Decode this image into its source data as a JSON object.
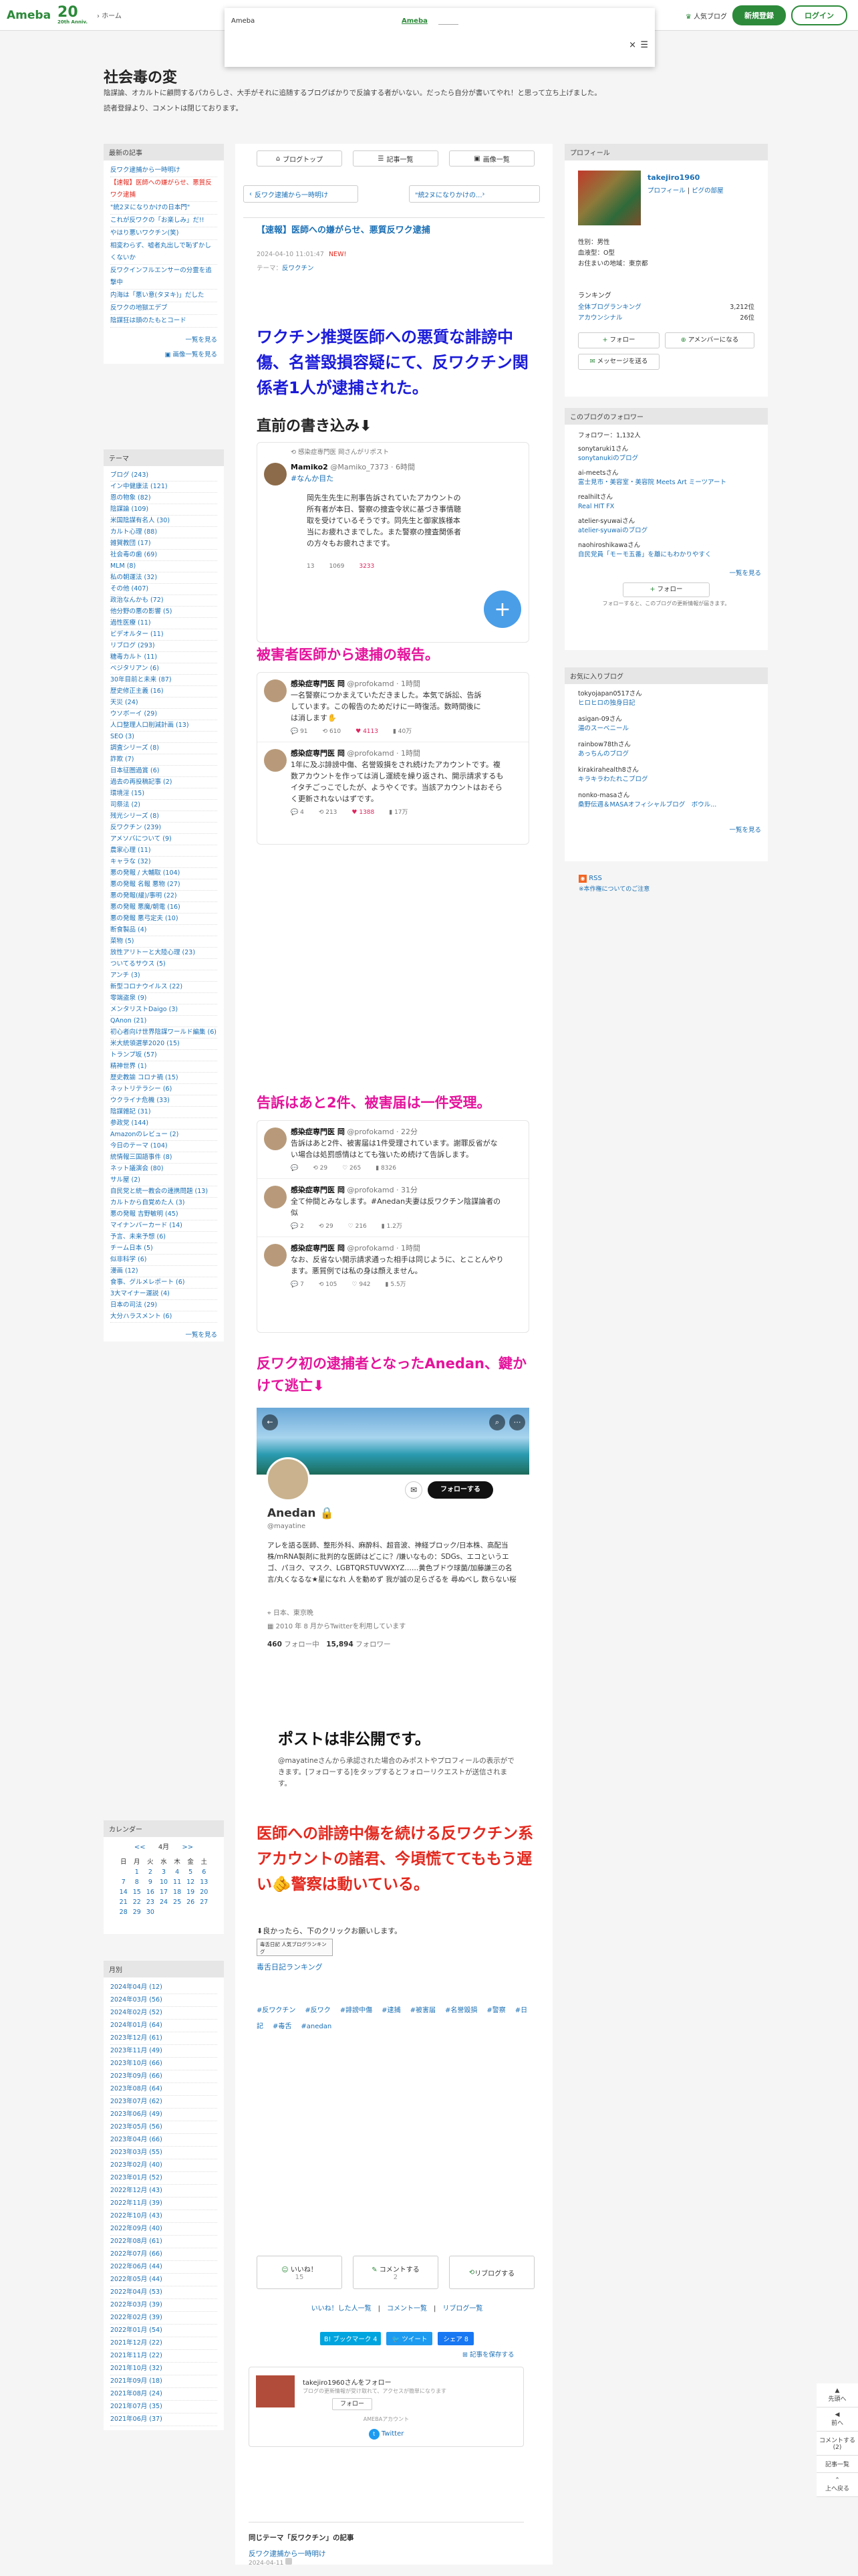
{
  "header": {
    "logo": "Ameba",
    "logo20": "20",
    "logo20_sub": "Ameba",
    "logo20_year": "20th Anniv.",
    "home": "ホーム",
    "popular": "人気ブログ",
    "signup": "新規登録",
    "login": "ログイン"
  },
  "popup": {
    "left": "Ameba",
    "mid": "Ameba",
    "close": "×"
  },
  "blog": {
    "title": "社会毒の変",
    "desc": "陰謀論、オカルトに顧問するパカらしさ、大手がそれに追随するブログばかりで反論する者がいない。だったら自分が書いてやれ！と思って立ち上げました。",
    "desc2": "読者登録より、コメントは閉じております。"
  },
  "left": {
    "recent_title": "最新の記事",
    "recent": [
      "反ワク逮捕から一時明け",
      "【速報】医師への嫌がらせ、悪質反ワク逮捕",
      "\"統2ヌになりかけの日本門\"",
      "これが反ワクの「お楽しみ」だ!!",
      "やはり悪いワクチン(笑)",
      "相変わらず、嘘者丸出しで恥ずかしくないか",
      "反ワクインフルエンサーの分霊を追撃中",
      "内海は「悪い意(タヌキ)」だした",
      "反ワクの地獄エデブ",
      "陰謀狂は頭のたもとコード"
    ],
    "recent_more": "一覧を見る",
    "recent_more2": "画像一覧を見る",
    "theme_title": "テーマ",
    "themes": [
      "ブログ (243)",
      "イン中健康法 (121)",
      "恩の物象 (82)",
      "陰謀論 (109)",
      "米国陰謀有名人 (30)",
      "カルト心理 (88)",
      "雑賀教団 (17)",
      "社会毒の歯 (69)",
      "MLM (8)",
      "私の朝運法 (32)",
      "その他 (407)",
      "政治なんかも (72)",
      "他分野の悪の影響 (5)",
      "過性医療 (11)",
      "ビデオルター (11)",
      "リブログ (293)",
      "糖毒カルト (11)",
      "ベジタリアン (6)",
      "30年目前と未来 (87)",
      "歴史修正主義 (16)",
      "天災 (24)",
      "ウソボーイ (29)",
      "人口整理人口削減計画 (13)",
      "SEO (3)",
      "調査シリーズ (8)",
      "詐欺 (7)",
      "日本征圏過賞 (6)",
      "過去の再投稿記事 (2)",
      "環境淫 (15)",
      "司祭法 (2)",
      "残光シリーズ (8)",
      "反ワクチン (239)",
      "アメソバについて (9)",
      "農家心理 (11)",
      "キャラな (32)",
      "悪の発報 / 大輔取 (104)",
      "悪の発報 名報 悪物 (27)",
      "悪の発報(緩)/事明 (22)",
      "悪の発報 悪魔/朝電 (16)",
      "悪の発報 悪弓定夫 (10)",
      "断食製品 (4)",
      "菜物 (5)",
      "放性アリトーと大陸心理 (23)",
      "ついてるサウス (5)",
      "アンチ (3)",
      "新型コロナウイルス (22)",
      "零端盗泉 (9)",
      "メンタリストDaigo (3)",
      "QAnon (21)",
      "初心者向け世界陰謀ワールド編集 (6)",
      "米大統領選挙2020 (15)",
      "トランプ坂 (57)",
      "精神世界 (1)",
      "歴史教諭 コロナ禍 (15)",
      "ネットリテラシー (6)",
      "ウクライナ危機 (33)",
      "陰謀雑記 (31)",
      "参政党 (144)",
      "Amazonのレビュー (2)",
      "今日のテーマ (104)",
      "統情報三国語事件 (8)",
      "ネット議演会 (80)",
      "サル屋 (2)",
      "自民党と統一教会の連携問題 (13)",
      "カルトから自覚めた人 (3)",
      "悪の発報 吉野敏明 (45)",
      "マイナンバーカード (14)",
      "予言、未来予想 (6)",
      "チーム日本 (5)",
      "似非科学 (6)",
      "漫画 (12)",
      "食事、グルメレポート (6)",
      "3大マイナー運説 (4)",
      "日本の司法 (29)",
      "大分ハラスメント (6)"
    ],
    "themes_more": "一覧を見る",
    "cal_title": "カレンダー",
    "cal_month": "4月",
    "cal_prev": "<<",
    "cal_next": ">>",
    "cal_head": [
      "日",
      "月",
      "火",
      "水",
      "木",
      "金",
      "土"
    ],
    "cal_rows": [
      [
        "",
        "1",
        "2",
        "3",
        "4",
        "5",
        "6"
      ],
      [
        "7",
        "8",
        "9",
        "10",
        "11",
        "12",
        "13"
      ],
      [
        "14",
        "15",
        "16",
        "17",
        "18",
        "19",
        "20"
      ],
      [
        "21",
        "22",
        "23",
        "24",
        "25",
        "26",
        "27"
      ],
      [
        "28",
        "29",
        "30",
        "",
        "",
        "",
        ""
      ]
    ],
    "month_title": "月別",
    "months": [
      "2024年04月 (12)",
      "2024年03月 (56)",
      "2024年02月 (52)",
      "2024年01月 (64)",
      "2023年12月 (61)",
      "2023年11月 (49)",
      "2023年10月 (66)",
      "2023年09月 (66)",
      "2023年08月 (64)",
      "2023年07月 (62)",
      "2023年06月 (49)",
      "2023年05月 (56)",
      "2023年04月 (66)",
      "2023年03月 (55)",
      "2023年02月 (40)",
      "2023年01月 (52)",
      "2022年12月 (43)",
      "2022年11月 (39)",
      "2022年10月 (43)",
      "2022年09月 (40)",
      "2022年08月 (61)",
      "2022年07月 (66)",
      "2022年06月 (44)",
      "2022年05月 (44)",
      "2022年04月 (53)",
      "2022年03月 (39)",
      "2022年02月 (39)",
      "2022年01月 (54)",
      "2021年12月 (22)",
      "2021年11月 (22)",
      "2021年10月 (32)",
      "2021年09月 (18)",
      "2021年08月 (24)",
      "2021年07月 (35)",
      "2021年06月 (37)"
    ]
  },
  "center": {
    "tab1": "ブログトップ",
    "tab2": "記事一覧",
    "tab3": "画像一覧",
    "prev": "反ワク逮捕から一時明け",
    "next": "\"統2ヌになりかけの...",
    "post_title": "【速報】医師への嫌がらせ、悪質反ワク逮捕",
    "date": "2024-04-10 11:01:47",
    "new": "NEW!",
    "theme_lbl": "テーマ：",
    "theme": "反ワクチン",
    "headline": "ワクチン推奨医師への悪質な誹謗中傷、名誉毀損容疑にて、反ワクチン関係者1人が逮捕された。",
    "h_write": "直前の書き込み⬇",
    "t1_rt": "感染症専門医 岡さんがリポスト",
    "t1_name": "Mamiko2",
    "t1_handle": "@Mamiko_7373 · 6時間",
    "t1_tag": "#なんか目た",
    "t1_body": "岡先生先生に刑事告訴されていたアカウントの所有者が本日、警察の捜査令状に基づき事情聴取を受けているそうです。同先生と御家族様本当にお疲れさまでした。また警察の捜査関係者の方々もお疲れさまです。",
    "t1_rp": "13",
    "t1_rt2": "1069",
    "t1_lk": "3233",
    "t1_vw": "",
    "h_report": "被害者医師から逮捕の報告。",
    "t2_name": "感染症専門医 岡",
    "t2_handle": "@profokamd · 1時間",
    "t2_body": "一名警察につかまえていただきました。本気で訴訟、告訴しています。この報告のためだけに一時復活。数時間後には消します✋",
    "t2_rp": "91",
    "t2_rt": "610",
    "t2_lk": "4113",
    "t2_vw": "40万",
    "t3_name": "感染症専門医 岡",
    "t3_handle": "@profokamd · 1時間",
    "t3_body": "1年に及ぶ誹謗中傷、名誉毀損をされ続けたアカウントです。複数アカウントを作っては消し運続を繰り返され、開示請求するもイタチごっこでしたが、ようやくです。当該アカウントはおそらく更新されないはずです。",
    "t3_rp": "4",
    "t3_rt": "213",
    "t3_lk": "1388",
    "t3_vw": "17万",
    "h_more": "告訴はあと2件、被害届は一件受理。",
    "t4_name": "感染症専門医 岡",
    "t4_handle": "@profokamd · 22分",
    "t4_body": "告訴はあと2件、被害届は1件受理されています。謝罪反省がない場合は処罰感情はとても強いため続けて告訴します。",
    "t4_rp": "",
    "t4_rt": "29",
    "t4_lk": "265",
    "t4_vw": "8326",
    "t5_name": "感染症専門医 岡",
    "t5_handle": "@profokamd · 31分",
    "t5_body": "全て仲間とみなします。#Anedan夫妻は反ワクチン陰謀論者の似",
    "t5_rp": "2",
    "t5_rt": "29",
    "t5_lk": "216",
    "t5_vw": "1.2万",
    "t6_name": "感染症専門医 岡",
    "t6_handle": "@profokamd · 1時間",
    "t6_body": "なお、反省ない開示請求通った相手は同じように、とことんやります。悪質例では私の身は顔えません。",
    "t6_rp": "7",
    "t6_rt": "105",
    "t6_lk": "942",
    "t6_vw": "5.5万",
    "h_anedan": "反ワク初の逮捕者となったAnedan、鍵かけて逃亡⬇",
    "an_name": "Anedan 🔒",
    "an_handle": "@mayatine",
    "an_follow": "フォローする",
    "an_bio": "アレを語る医師、整形外科、麻酔科、超音波、神経ブロック/日本株、高配当株/mRNA製剤に批判的な医師はどこに？/嫌いなもの：SDGs、エコというエゴ、パヨク、マスク、LGBTQRSTUVWXYZ……黄色ブドウ球菌/加藤謙三の名言/丸くなるな★星になれ 人を動めず 我が誠の足らざるを 尋ぬべし 数らない桜",
    "an_loc": "日本、東京晩",
    "an_join": "2010 年 8 月からTwitterを利用しています",
    "an_fl": "460",
    "an_fl_lbl": "フォロー中",
    "an_fw": "15,894",
    "an_fw_lbl": "フォロワー",
    "private": "ポストは非公開です。",
    "private_sub": "@mayatineさんから承認された場合のみポストやプロフィールの表示ができます。[フォローする]をタップするとフォローリクエストが送信されます。",
    "h_warn": "医師への誹謗中傷を続ける反ワクチン系アカウントの諸君、今頃慌ててももう遅い🫵警察は動いている。",
    "below": "⬇良かったら、下のクリックお願いします。",
    "rank_badge": "毒舌日記 人気ブログランキング",
    "rank_link": "毒舌日記ランキング",
    "tags": [
      "#反ワクチン",
      "#反ワク",
      "#誹謗中傷",
      "#逮捕",
      "#被害届",
      "#名誉毀損",
      "#警察",
      "#日記",
      "#毒舌",
      "#anedan"
    ],
    "like": "いいね！",
    "like_n": "15",
    "comment": "コメントする",
    "comment_n": "2",
    "reblog": "リブログする",
    "like_list": "いいね！した人一覧",
    "comment_list": "コメント一覧",
    "reblog_list": "リブログ一覧",
    "bookmark": "B! ブックマーク",
    "bm_n": "4",
    "tweet": "ツイート",
    "fb": "シェア",
    "fb_n": "8",
    "save": "記事を保存する",
    "follow_card": "takejiro1960さんをフォロー",
    "follow_sub": "ブログの更新情報が受け取れて、アクセスが簡単になります",
    "follow_btn": "フォロー",
    "ameba_acct": "AMEBAアカウント",
    "twitter": "Twitter",
    "same_theme": "同じテーマ「反ワクチン」の記事",
    "same_item": "反ワク逮捕から一時明け",
    "same_date": "2024-04-11"
  },
  "right": {
    "profile_title": "プロフィール",
    "name": "takejiro1960",
    "profile_link": "プロフィール",
    "blog_link": "ピグの部屋",
    "gender": "性別：男性",
    "blood": "血液型：O型",
    "loc": "お住まいの地域：東京都",
    "ranking": "ランキング",
    "rank_all": "全体ブログランキング",
    "rank_all_v": "3,212位",
    "rank_ab": "アカウンシナル",
    "rank_ab_v": "26位",
    "follow_btn": "フォロー",
    "member_btn": "アメンバーになる",
    "msg_btn": "メッセージを送る",
    "followers_title": "このブログのフォロワー",
    "followers_count": "フォロワー：1,132人",
    "followers": [
      [
        "sonytaruki1さん",
        "sonytanukiのブログ"
      ],
      [
        "ai-meetsさん",
        "富士見市・美容室・美容院 Meets Art ミーツアート"
      ],
      [
        "realhiltさん",
        "Real HIT FX"
      ],
      [
        "atelier-syuwaiさん",
        "atelier-syuwaiのブログ"
      ],
      [
        "naohiroshikawaさん",
        "自民党員「モーモ五番」を離にもわかりやすく"
      ]
    ],
    "followers_more": "一覧を見る",
    "follow_btn2": "フォロー",
    "follow_note": "フォローすると、このブログの更新情報が届きます。",
    "fav_title": "お気に入りブログ",
    "favs": [
      [
        "tokyojapan0517さん",
        "ヒロヒロの独身日記"
      ],
      [
        "asigan-09さん",
        "湯のスーベニール"
      ],
      [
        "rainbow78thさん",
        "あっちんのブログ"
      ],
      [
        "kirakirahealth8さん",
        "キラキラわたれこブログ"
      ],
      [
        "nonko-masaさん",
        "桑野伝週＆MASAオフィシャルブログ　ボウル..."
      ]
    ],
    "favs_more": "一覧を見る",
    "rss": "RSS",
    "rss_sub": "※本作権についてのご注意"
  },
  "side": {
    "up": "先頭へ",
    "prev": "前へ",
    "comment": "コメントする",
    "comment_n": "2",
    "article": "記事一覧",
    "top": "上へ戻る"
  }
}
